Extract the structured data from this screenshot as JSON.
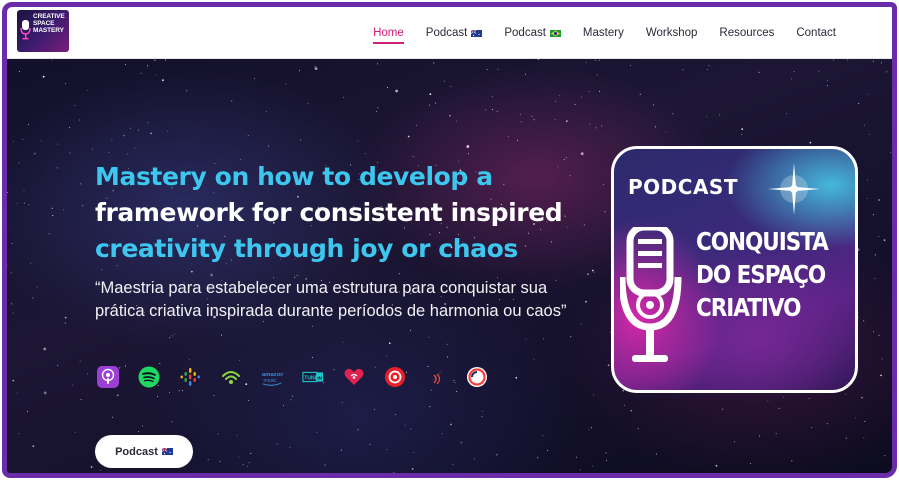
{
  "brand": {
    "logo_lines": [
      "CREATIVE",
      "SPACE",
      "MASTERY"
    ]
  },
  "nav": {
    "items": [
      {
        "label": "Home",
        "active": true,
        "flag": ""
      },
      {
        "label": "Podcast",
        "active": false,
        "flag": "au"
      },
      {
        "label": "Podcast",
        "active": false,
        "flag": "br"
      },
      {
        "label": "Mastery",
        "active": false,
        "flag": ""
      },
      {
        "label": "Workshop",
        "active": false,
        "flag": ""
      },
      {
        "label": "Resources",
        "active": false,
        "flag": ""
      },
      {
        "label": "Contact",
        "active": false,
        "flag": ""
      }
    ],
    "active_color": "#d0207a"
  },
  "hero": {
    "headline_line1": "Mastery on how to develop a",
    "headline_line2": "framework for consistent inspired",
    "headline_line3": "creativity through joy or chaos",
    "quote": "“Maestria para estabelecer uma estrutura para conquistar sua prática criativa inspirada durante períodos de harmonia ou caos”",
    "platforms": [
      "apple-podcasts-icon",
      "spotify-icon",
      "google-podcasts-icon",
      "podcast-addict-icon",
      "amazon-music-icon",
      "tunein-icon",
      "iheartradio-icon",
      "castbox-icon",
      "overcast-icon",
      "pocket-casts-icon"
    ],
    "cta_label": "Podcast",
    "cta_flag": "au",
    "accent_color": "#3ec7ee"
  },
  "cover": {
    "label": "PODCAST",
    "title_lines": [
      "CONQUISTA",
      "DO ESPAÇO",
      "CRIATIVO"
    ]
  },
  "frame_color": "#6a2ca8"
}
